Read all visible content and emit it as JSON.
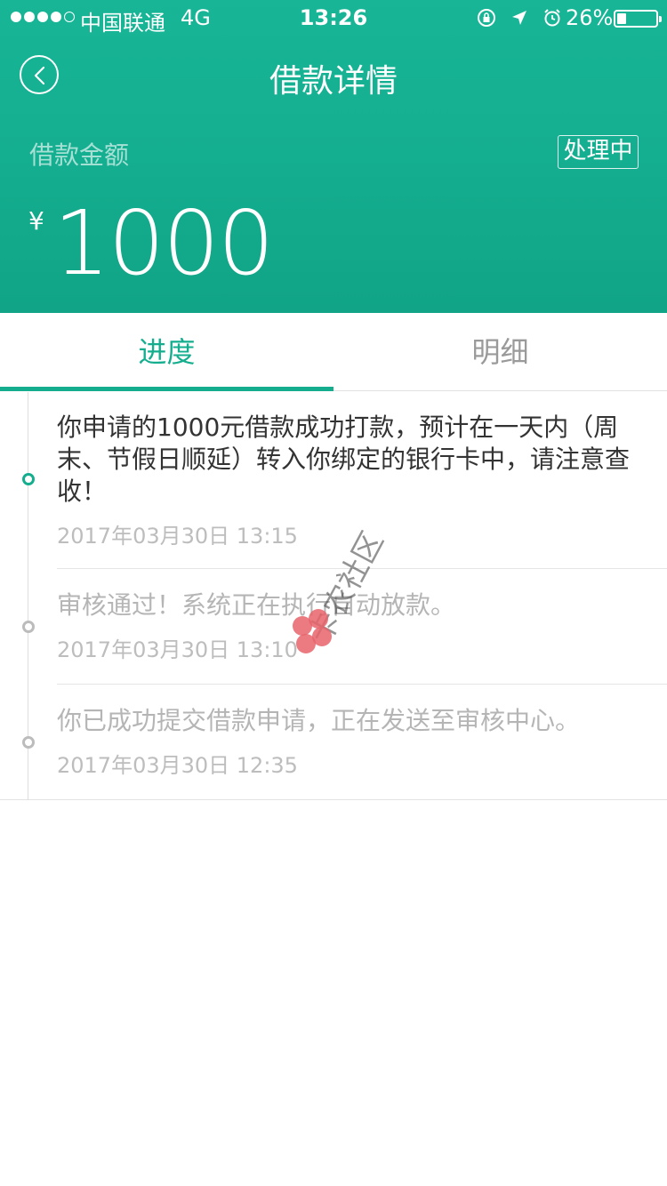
{
  "status_bar": {
    "carrier": "中国联通",
    "network": "4G",
    "time": "13:26",
    "battery": "26%",
    "signal_bars": 4,
    "icons": [
      "rotation-lock-icon",
      "location-arrow-icon",
      "alarm-icon",
      "battery-icon"
    ]
  },
  "nav": {
    "title": "借款详情",
    "back_icon": "chevron-left-icon"
  },
  "loan": {
    "amount_label": "借款金额",
    "status": "处理中",
    "currency": "¥",
    "amount": "1000"
  },
  "tabs": [
    {
      "label": "进度",
      "active": true
    },
    {
      "label": "明细",
      "active": false
    }
  ],
  "timeline": [
    {
      "text": "你申请的1000元借款成功打款，预计在一天内（周末、节假日顺延）转入你绑定的银行卡中，请注意查收！",
      "time": "2017年03月30日 13:15",
      "active": true
    },
    {
      "text": "审核通过！系统正在执行自动放款。",
      "time": "2017年03月30日 13:10",
      "active": false
    },
    {
      "text": "你已成功提交借款申请，正在发送至审核中心。",
      "time": "2017年03月30日 12:35",
      "active": false
    }
  ],
  "watermark": {
    "text": "卡农社区"
  },
  "colors": {
    "brand": "#14ae8f",
    "inactive_text": "#b5b5b5",
    "active_text": "#333333"
  }
}
